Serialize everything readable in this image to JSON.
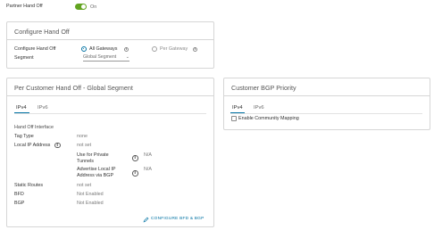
{
  "partner_hand_off": {
    "label": "Partner Hand Off",
    "toggle_state": "On"
  },
  "configure_hand_off": {
    "title": "Configure Hand Off",
    "configure_label": "Configure Hand Off",
    "options": [
      {
        "label": "All Gateways",
        "selected": true
      },
      {
        "label": "Per Gateway",
        "selected": false
      }
    ],
    "segment_label": "Segment",
    "segment_value": "Global Segment"
  },
  "per_customer": {
    "title": "Per Customer Hand Off - Global Segment",
    "tabs": [
      "IPv4",
      "IPv6"
    ],
    "active_tab": "IPv4",
    "section_heading": "Hand Off Interface",
    "fields": {
      "tag_type": {
        "label": "Tag Type",
        "value": "none"
      },
      "local_ip": {
        "label": "Local IP Address",
        "value": "not set"
      },
      "use_private_tunnels": {
        "label_line1": "Use for Private",
        "label_line2": "Tunnels",
        "value": "N/A"
      },
      "advertise_local_ip": {
        "label_line1": "Advertise Local IP",
        "label_line2": "Address via BGP",
        "value": "N/A"
      },
      "static_routes": {
        "label": "Static Routes",
        "value": "not set"
      },
      "bfd": {
        "label": "BFD",
        "value": "Not Enabled"
      },
      "bgp": {
        "label": "BGP",
        "value": "Not Enabled"
      }
    },
    "configure_link": "CONFIGURE BFD & BGP"
  },
  "customer_bgp": {
    "title": "Customer BGP Priority",
    "tabs": [
      "IPv4",
      "IPv6"
    ],
    "active_tab": "IPv4",
    "checkbox_label": "Enable Community Mapping",
    "checkbox_checked": false
  },
  "colors": {
    "accent": "#0072a3",
    "toggle_on": "#62a420",
    "border": "#d6d6d6"
  },
  "icons": [
    "info-icon",
    "pencil-icon",
    "chevron-down-icon"
  ]
}
